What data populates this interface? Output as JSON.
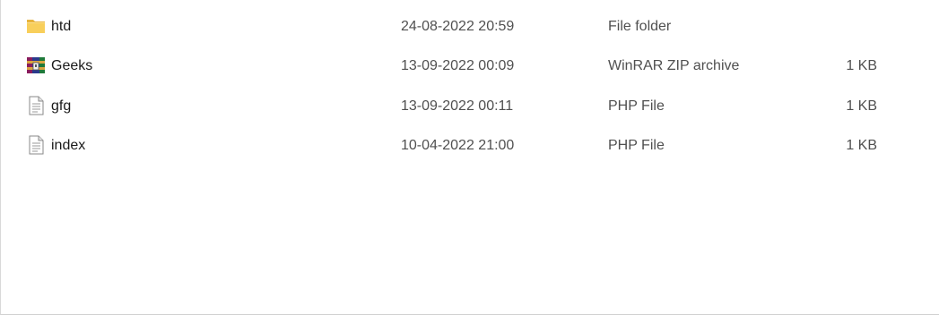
{
  "files": [
    {
      "name": "htd",
      "date_modified": "24-08-2022 20:59",
      "type": "File folder",
      "size": "",
      "icon": "folder-icon"
    },
    {
      "name": "Geeks",
      "date_modified": "13-09-2022 00:09",
      "type": "WinRAR ZIP archive",
      "size": "1 KB",
      "icon": "winrar-archive-icon"
    },
    {
      "name": "gfg",
      "date_modified": "13-09-2022 00:11",
      "type": "PHP File",
      "size": "1 KB",
      "icon": "file-icon"
    },
    {
      "name": "index",
      "date_modified": "10-04-2022 21:00",
      "type": "PHP File",
      "size": "1 KB",
      "icon": "file-icon"
    }
  ],
  "colors": {
    "folder": "#f8cf5b",
    "text": "#1f1f1f",
    "secondary_text": "#505050"
  }
}
